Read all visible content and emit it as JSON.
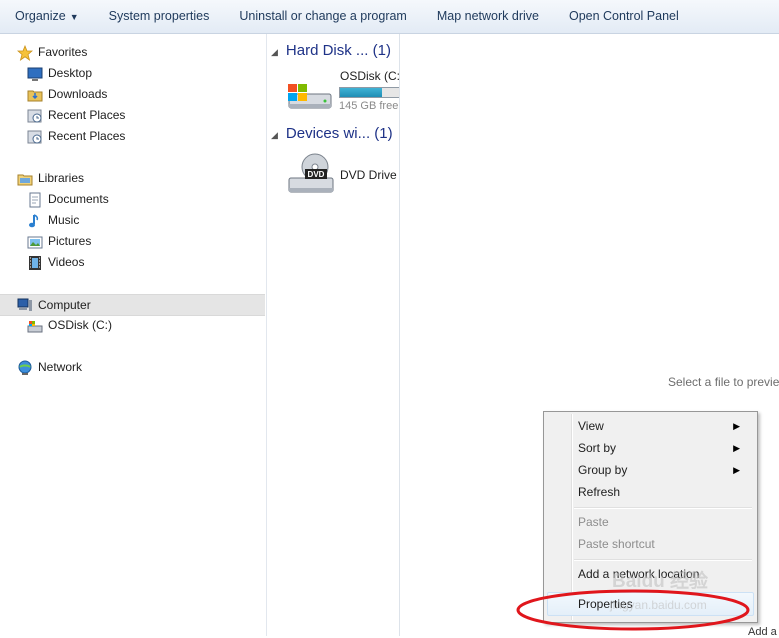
{
  "toolbar": {
    "organize": "Organize",
    "system_properties": "System properties",
    "uninstall": "Uninstall or change a program",
    "map_drive": "Map network drive",
    "control_panel": "Open Control Panel"
  },
  "nav": {
    "favorites": "Favorites",
    "desktop": "Desktop",
    "downloads": "Downloads",
    "recent1": "Recent Places",
    "recent2": "Recent Places",
    "libraries": "Libraries",
    "documents": "Documents",
    "music": "Music",
    "pictures": "Pictures",
    "videos": "Videos",
    "computer": "Computer",
    "osdisk": "OSDisk (C:)",
    "network": "Network"
  },
  "content": {
    "hard_disk_group": "Hard Disk ... (1)",
    "osdisk_name": "OSDisk (C:)",
    "osdisk_free": "145 GB free",
    "osdisk_used_fraction": 0.7,
    "devices_group": "Devices wi... (1)",
    "dvd_name": "DVD Drive (",
    "dvd_label": "DVD"
  },
  "preview": {
    "message": "Select a file to preview"
  },
  "context_menu": {
    "view": "View",
    "sort_by": "Sort by",
    "group_by": "Group by",
    "refresh": "Refresh",
    "paste": "Paste",
    "paste_shortcut": "Paste shortcut",
    "add_network_location": "Add a network location",
    "properties": "Properties"
  },
  "watermark": {
    "text": "Baidu 经验",
    "url": "jingyan.baidu.com"
  },
  "bottom_fragment": "Add a",
  "colors": {
    "annotation": "#e0161c",
    "group_header": "#1e3287",
    "drive_bar": "#26a0c8"
  }
}
